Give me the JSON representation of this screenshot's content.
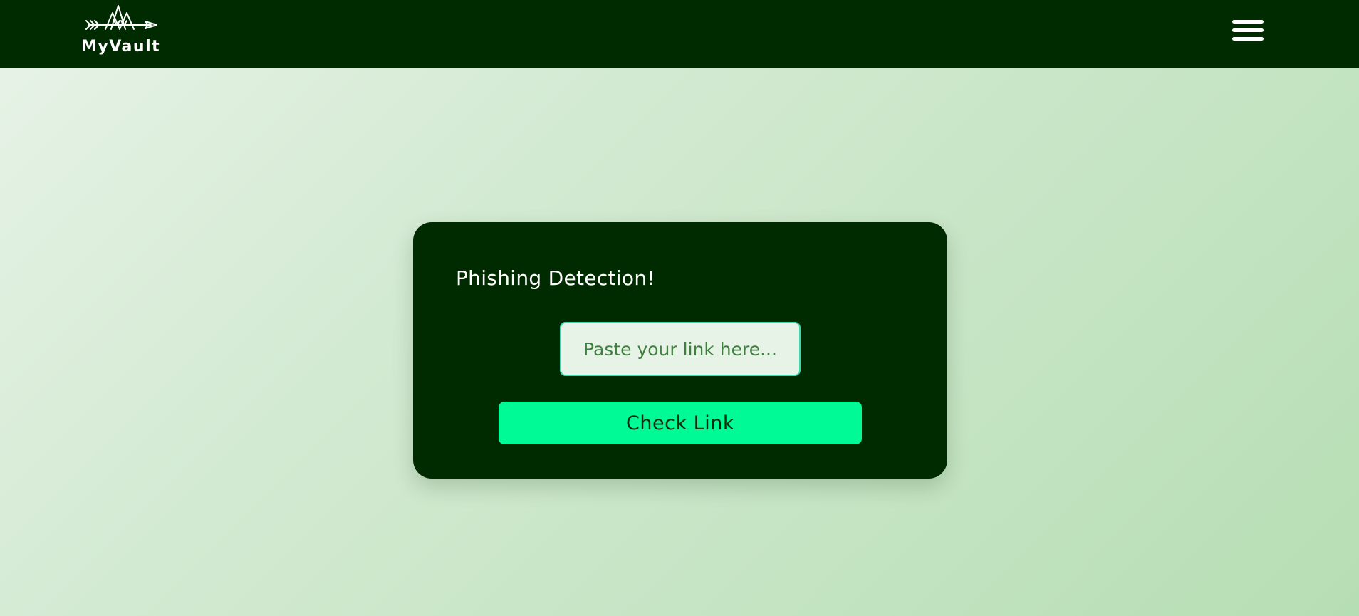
{
  "navbar": {
    "logo_text": "MyVault",
    "logo_icon": "mountain-arrow-logo",
    "menu_icon": "hamburger-menu-icon",
    "background_color": "#002b00"
  },
  "card": {
    "title": "Phishing Detection!",
    "input": {
      "value": "",
      "placeholder": "Paste your link here..."
    },
    "button_label": "Check Link",
    "background_color": "#002b00",
    "button_color": "#00fb96"
  }
}
